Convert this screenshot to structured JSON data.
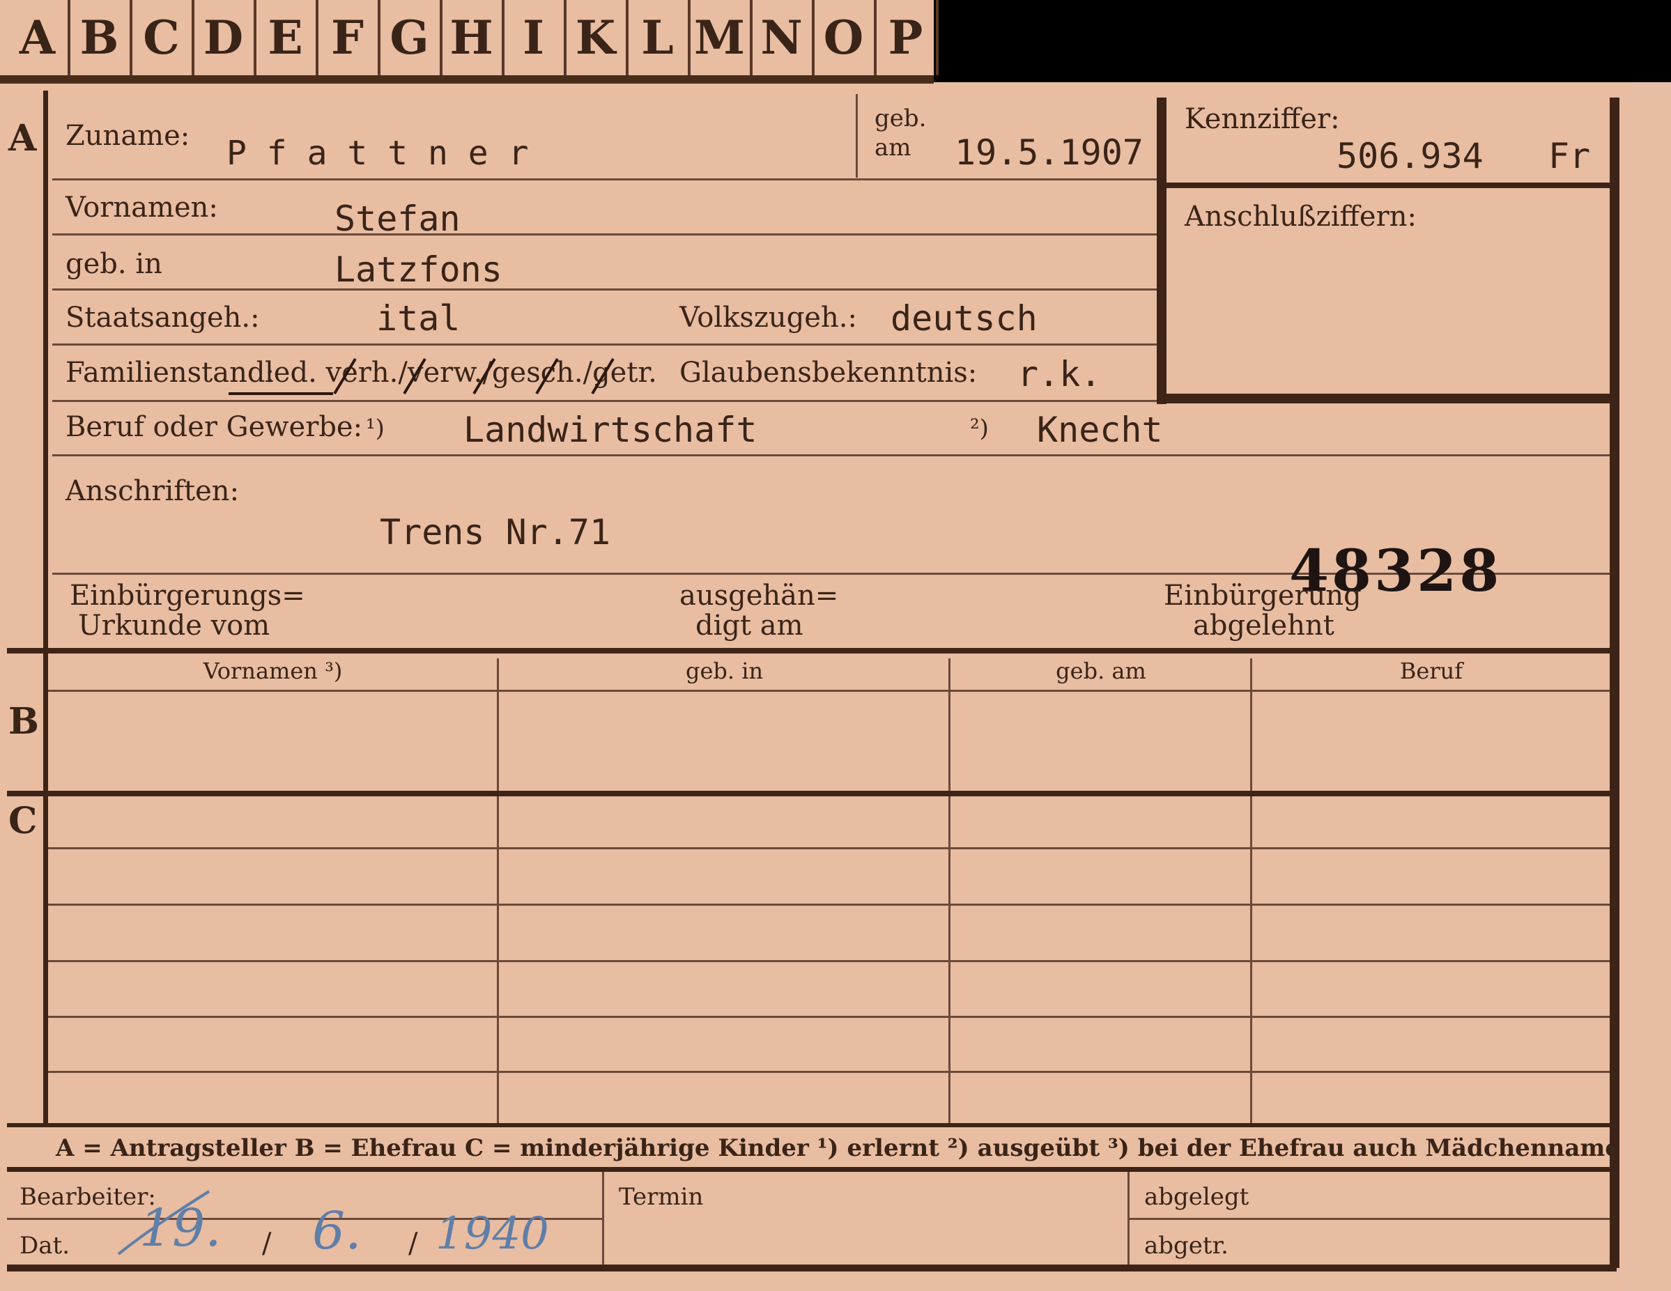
{
  "tabs": [
    "A",
    "B",
    "C",
    "D",
    "E",
    "F",
    "G",
    "H",
    "I",
    "K",
    "L",
    "M",
    "N",
    "O",
    "P"
  ],
  "sections": {
    "a": "A",
    "b": "B",
    "c": "C"
  },
  "labels": {
    "zuname": "Zuname:",
    "geb_am_1": "geb.",
    "geb_am_2": "am",
    "kennziffer": "Kennziffer:",
    "anschluss": "Anschlußziffern:",
    "vornamen": "Vornamen:",
    "geb_in": "geb. in",
    "staatsangeh": "Staatsangeh.:",
    "volkszugeh": "Volkszugeh.:",
    "familienstand": "Familienstand:",
    "familienstand_opts": "led. verh./verw./gesch./getr.",
    "glaubens": "Glaubensbekenntnis:",
    "beruf": "Beruf oder Gewerbe:",
    "beruf_1": "¹)",
    "beruf_2": "²)",
    "anschriften": "Anschriften:",
    "einb_1": "Einbürgerungs=",
    "einb_2": "Urkunde vom",
    "ausg_1": "ausgehän=",
    "ausg_2": "digt am",
    "abgel_1": "Einbürgerung",
    "abgel_2": "abgelehnt"
  },
  "values": {
    "zuname": "P f a t t n e r",
    "geb_am": "19.5.1907",
    "kennziffer": "506.934",
    "kennziffer_suffix": "Fr",
    "vornamen": "Stefan",
    "geb_in": "Latzfons",
    "staatsangeh": "ital",
    "volkszugeh": "deutsch",
    "glaubens": "r.k.",
    "beruf_1": "Landwirtschaft",
    "beruf_2": "Knecht",
    "anschrift": "Trens  Nr.71",
    "stamp_number": "48328"
  },
  "table_headers": [
    "Vornamen ³)",
    "geb. in",
    "geb. am",
    "Beruf"
  ],
  "footer_legend": "A = Antragsteller   B = Ehefrau   C = minderjährige Kinder   ¹) erlernt   ²) ausgeübt   ³) bei der Ehefrau auch Mädchenname",
  "bottom": {
    "bearbeiter": "Bearbeiter:",
    "dat": "Dat.",
    "termin": "Termin",
    "abgelegt": "abgelegt",
    "abgetr": "abgetr.",
    "date_day": "19.",
    "date_month": "6.",
    "date_year": "1940"
  },
  "colors": {
    "card": "#e8bda2",
    "ink": "#3a2418",
    "pencil": "#5f7ea8",
    "stamp": "#1e1412"
  }
}
